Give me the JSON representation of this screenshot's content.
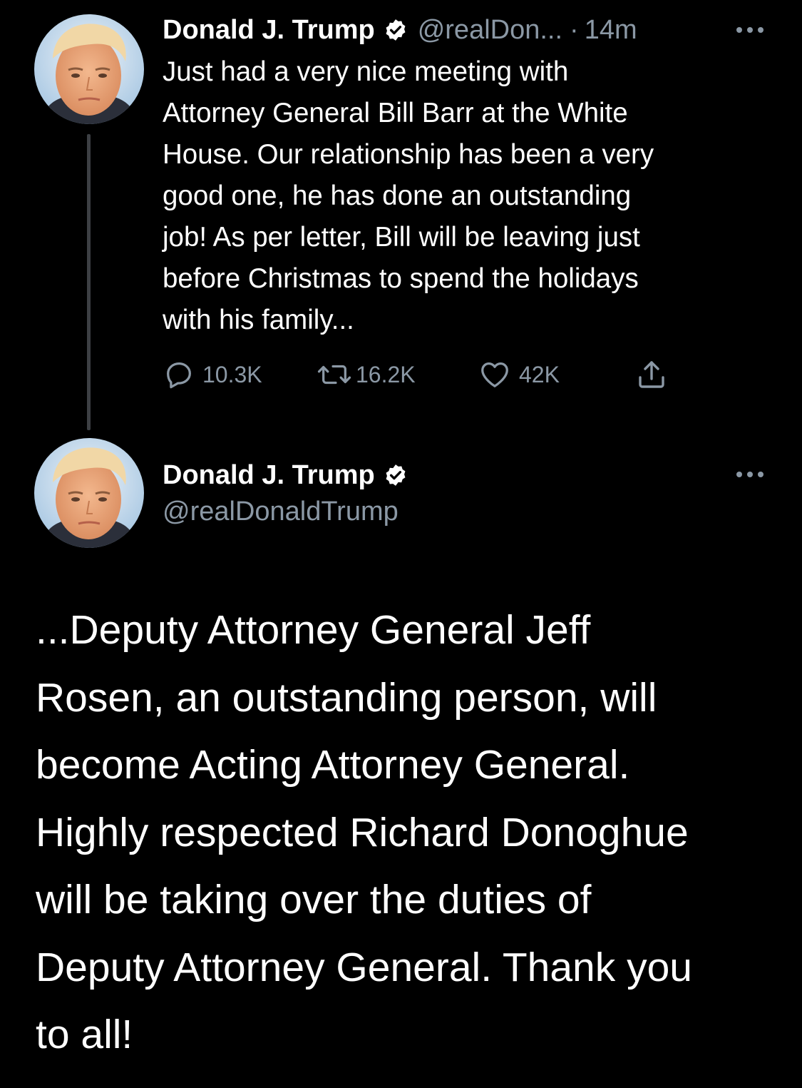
{
  "tweet1": {
    "avatar_icon": "user-avatar-photo",
    "display_name": "Donald J. Trump",
    "verified_icon": "verified-badge-icon",
    "handle_truncated": "@realDon...",
    "separator": "·",
    "timestamp": "14m",
    "more_icon": "more-options-icon",
    "text_lines": [
      "Just had a very nice meeting with",
      "Attorney General Bill Barr at the White",
      "House. Our relationship has been a very",
      "good one, he has done an outstanding",
      "job! As per letter, Bill will be leaving just",
      "before Christmas to spend the holidays",
      "with his family..."
    ],
    "actions": {
      "reply": {
        "icon": "reply-icon",
        "count": "10.3K"
      },
      "retweet": {
        "icon": "retweet-icon",
        "count": "16.2K"
      },
      "like": {
        "icon": "like-icon",
        "count": "42K"
      },
      "share": {
        "icon": "share-icon"
      }
    }
  },
  "tweet2": {
    "avatar_icon": "user-avatar-photo",
    "display_name": "Donald J. Trump",
    "verified_icon": "verified-badge-icon",
    "handle": "@realDonaldTrump",
    "more_icon": "more-options-icon",
    "text_lines": [
      "...Deputy Attorney General Jeff",
      "Rosen, an outstanding person, will",
      "become Acting Attorney General.",
      "Highly respected Richard Donoghue",
      "will be taking over the duties of",
      "Deputy Attorney General. Thank you",
      "to all!"
    ]
  },
  "colors": {
    "background": "#000000",
    "primary_text": "#ffffff",
    "secondary_text": "#8b98a5",
    "thread_line": "#3d4044"
  }
}
